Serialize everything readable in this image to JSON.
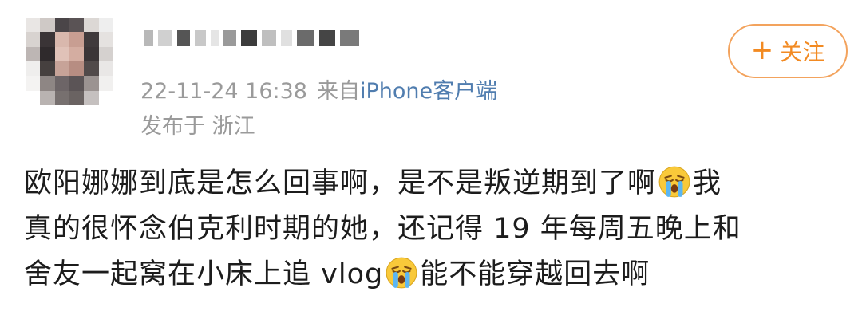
{
  "post": {
    "timestamp": "22-11-24 16:38",
    "source_prefix": "来自",
    "source_device": "iPhone",
    "source_client": "客户端",
    "location_label": "发布于",
    "location": "浙江",
    "follow_button_label": "关注",
    "content": {
      "line1_text": "欧阳娜娜到底是怎么回事啊，是不是叛逆期到了啊",
      "line1_after_emoji": "我",
      "line2_text": "真的很怀念伯克利时期的她，还记得 19 年每周五晚上和",
      "line3_text": "舍友一起窝在小床上追 vlog",
      "line3_after_emoji": "能不能穿越回去啊"
    },
    "emoji_name": "crying-face-icon"
  },
  "colors": {
    "follow_accent": "#f28a22",
    "link": "#507daf",
    "meta_gray": "#9a9a9a",
    "text": "#1c1c1c"
  }
}
